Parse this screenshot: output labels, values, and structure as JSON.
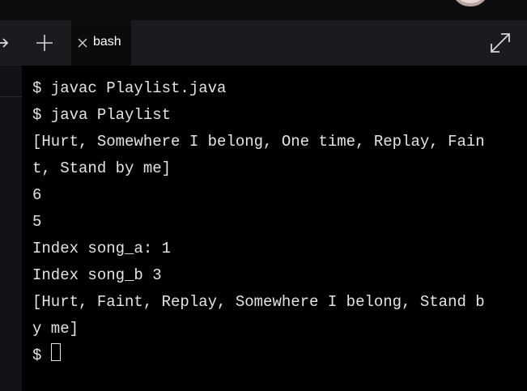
{
  "tabbar": {
    "tab_label": "bash",
    "icons": {
      "new_tab": "plus-icon",
      "close_tab": "close-icon",
      "expand": "expand-icon",
      "side_arrow": "arrow-icon"
    }
  },
  "terminal": {
    "lines": [
      "$ javac Playlist.java",
      "$ java Playlist",
      "[Hurt, Somewhere I belong, One time, Replay, Fain",
      "t, Stand by me]",
      "6",
      "5",
      "Index song_a: 1",
      "Index song_b 3",
      "[Hurt, Faint, Replay, Somewhere I belong, Stand b",
      "y me]"
    ],
    "prompt": "$"
  },
  "colors": {
    "background": "#000000",
    "tabbar": "#1b1b1f",
    "text": "#e4e4e4"
  }
}
